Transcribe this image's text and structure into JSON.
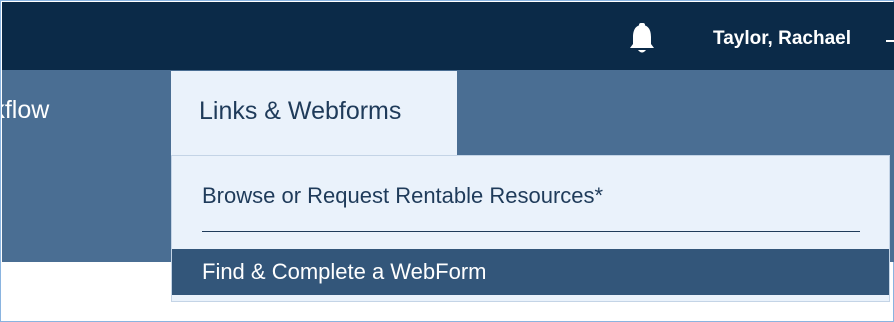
{
  "header": {
    "user_name": "Taylor, Rachael"
  },
  "nav": {
    "partial_item_label": "rkflow",
    "active_tab_label": "Links & Webforms"
  },
  "dropdown": {
    "items": [
      {
        "label": "Browse or Request Rentable Resources*"
      },
      {
        "label": "Find & Complete a WebForm"
      }
    ]
  },
  "icons": {
    "notification": "bell-icon",
    "user_menu": "chevron-down-icon"
  },
  "colors": {
    "topbar": "#0b2a48",
    "navbar": "#4a6e93",
    "dropdown_bg": "#eaf2fb",
    "highlight": "#33567a"
  }
}
